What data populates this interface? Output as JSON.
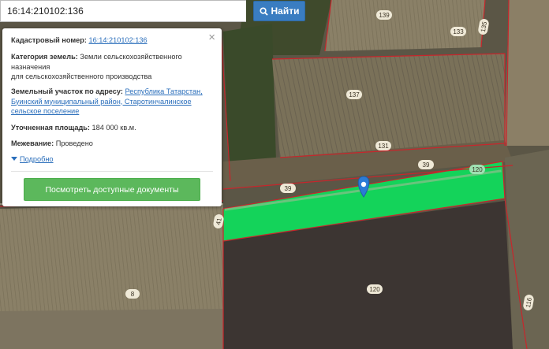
{
  "search": {
    "value": "16:14:210102:136",
    "button_label": "Найти"
  },
  "popup": {
    "cadastral_label": "Кадастровый номер:",
    "cadastral_value": "16:14:210102:136",
    "category_label": "Категория земель:",
    "category_value_1": "Земли сельскохозяйственного",
    "category_value_2": "назначения",
    "category_value_3": "для сельскохозяйственного производства",
    "address_label": "Земельный участок по адресу:",
    "address_value_1": "Республика Татарстан,",
    "address_value_2": "Буинский муниципальный район, Старотинчалинское",
    "address_value_3": "сельское поселение",
    "area_label": "Уточненная площадь:",
    "area_value": "184 000 кв.м.",
    "survey_label": "Межевание:",
    "survey_value": "Проведено",
    "details_link": "Подробно",
    "docs_button": "Посмотреть доступные документы",
    "close_symbol": "×"
  },
  "map": {
    "parcel_labels": [
      "139",
      "133",
      "135",
      "137",
      "131",
      "39",
      "39",
      "120",
      "120",
      "8",
      "41",
      "116"
    ],
    "colors": {
      "selected_parcel": "#14d35a",
      "parcel_border": "#c8262c",
      "marker": "#2b7bd6"
    }
  }
}
